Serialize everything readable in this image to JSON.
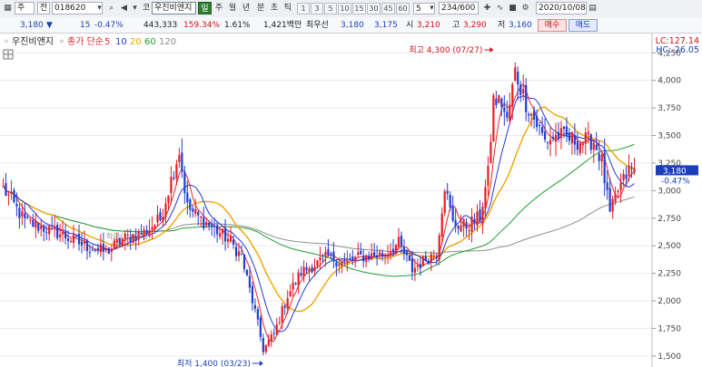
{
  "toolbar": {
    "market": "주",
    "search_label": "전",
    "code": "018620",
    "mode_label": "코",
    "stock_name": "우진비앤지",
    "period_tabs": [
      "일",
      "주",
      "월",
      "년",
      "분",
      "초",
      "틱"
    ],
    "numbers": [
      "1",
      "3",
      "5",
      "10",
      "15",
      "30",
      "45",
      "60",
      "5"
    ],
    "count": "234",
    "count_total": "/600",
    "date": "2020/10/08"
  },
  "info": {
    "price": "3,180",
    "change": "15",
    "change_pct": "-0.47%",
    "volume": "443,333",
    "vol_ratio": "159.34%",
    "turnover": "1.61%",
    "amount": "1,421백만",
    "best_label": "최우선",
    "bid": "3,180",
    "ask": "3,175",
    "open_label": "시",
    "open": "3,210",
    "high_label": "고",
    "high": "3,290",
    "low_label": "저",
    "low": "3,160",
    "buy_label": "매수",
    "sell_label": "매도"
  },
  "legend": {
    "name": "우진비앤지",
    "ma_label": "종가 단순",
    "periods": [
      "5",
      "10",
      "20",
      "60",
      "120"
    ]
  },
  "colors": {
    "up": "#e81d25",
    "down": "#1f3fd1",
    "ma5": "#e8262e",
    "ma10": "#2438d4",
    "ma20": "#f0a400",
    "ma60": "#1e9e2e",
    "ma120": "#8d8d8d"
  },
  "chart_data": {
    "type": "candlestick",
    "ylim": [
      1400,
      4400
    ],
    "yticks": [
      1500,
      1750,
      2000,
      2250,
      2500,
      2750,
      3000,
      3250,
      3500,
      3750,
      4000,
      4250
    ],
    "ytick_labels": [
      "1,500",
      "1,750",
      "2,000",
      "2,250",
      "2,500",
      "2,750",
      "3,000",
      "3,250",
      "3,500",
      "3,750",
      "4,000",
      "4,250"
    ],
    "lc_label": "LC:127.14",
    "hc_label": "HC:-26.05",
    "last_price_label": "3,180",
    "last_change_label": "-0.47%",
    "max_annotation": "최고 4,300 (07/27)",
    "min_annotation": "최저 1,400 (03/23)",
    "faint_annotation": "하당(1.03%)",
    "keypoints": [
      {
        "i": 0,
        "p": 3020
      },
      {
        "i": 8,
        "p": 2720
      },
      {
        "i": 20,
        "p": 2620
      },
      {
        "i": 30,
        "p": 2500
      },
      {
        "i": 38,
        "p": 2440
      },
      {
        "i": 44,
        "p": 2560
      },
      {
        "i": 52,
        "p": 2620
      },
      {
        "i": 58,
        "p": 2740
      },
      {
        "i": 62,
        "p": 3100
      },
      {
        "i": 65,
        "p": 3360
      },
      {
        "i": 68,
        "p": 2850
      },
      {
        "i": 72,
        "p": 2760
      },
      {
        "i": 78,
        "p": 2650
      },
      {
        "i": 83,
        "p": 2560
      },
      {
        "i": 88,
        "p": 2400
      },
      {
        "i": 93,
        "p": 1900
      },
      {
        "i": 96,
        "p": 1560
      },
      {
        "i": 100,
        "p": 1700
      },
      {
        "i": 105,
        "p": 2050
      },
      {
        "i": 110,
        "p": 2260
      },
      {
        "i": 115,
        "p": 2330
      },
      {
        "i": 120,
        "p": 2400
      },
      {
        "i": 126,
        "p": 2340
      },
      {
        "i": 132,
        "p": 2400
      },
      {
        "i": 140,
        "p": 2420
      },
      {
        "i": 146,
        "p": 2520
      },
      {
        "i": 151,
        "p": 2280
      },
      {
        "i": 156,
        "p": 2380
      },
      {
        "i": 160,
        "p": 2440
      },
      {
        "i": 163,
        "p": 3050
      },
      {
        "i": 166,
        "p": 2700
      },
      {
        "i": 171,
        "p": 2680
      },
      {
        "i": 176,
        "p": 2760
      },
      {
        "i": 179,
        "p": 3150
      },
      {
        "i": 181,
        "p": 3820
      },
      {
        "i": 184,
        "p": 3800
      },
      {
        "i": 186,
        "p": 3620
      },
      {
        "i": 189,
        "p": 4080
      },
      {
        "i": 193,
        "p": 3800
      },
      {
        "i": 197,
        "p": 3600
      },
      {
        "i": 200,
        "p": 3450
      },
      {
        "i": 205,
        "p": 3500
      },
      {
        "i": 212,
        "p": 3450
      },
      {
        "i": 218,
        "p": 3450
      },
      {
        "i": 221,
        "p": 3260
      },
      {
        "i": 224,
        "p": 2780
      },
      {
        "i": 227,
        "p": 3000
      },
      {
        "i": 231,
        "p": 3180
      },
      {
        "i": 233,
        "p": 3180
      }
    ],
    "candle_count": 234
  }
}
